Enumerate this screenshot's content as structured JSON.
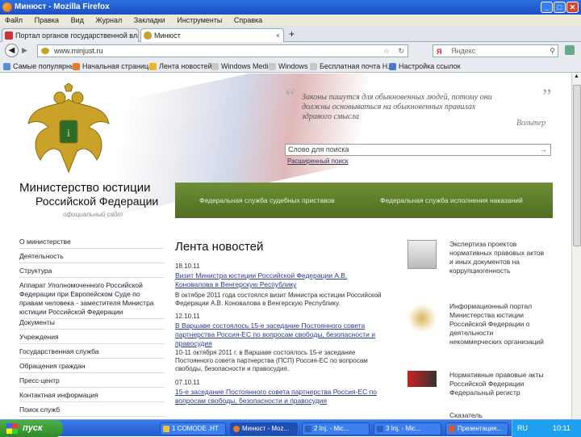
{
  "window": {
    "title": "Минюст - Mozilla Firefox"
  },
  "menu": [
    "Файл",
    "Правка",
    "Вид",
    "Журнал",
    "Закладки",
    "Инструменты",
    "Справка"
  ],
  "tabs": [
    {
      "label": "Портал органов государственной влас...",
      "active": false
    },
    {
      "label": "Минюст",
      "active": true
    }
  ],
  "nav": {
    "url": "www.minjust.ru",
    "search_placeholder": "Яндекс"
  },
  "bookmarks": [
    "Самые популярные",
    "Начальная страница",
    "Лента новостей",
    "Windows Media",
    "Windows",
    "Бесплатная почта H...",
    "Настройка ссылок"
  ],
  "header": {
    "quote": "Законы пишутся для обыкновенных людей, потому они должны основываться на обыкновенных правилах здравого смысла",
    "quote_author": "Вольтер",
    "search_placeholder": "Слово для поиска",
    "search_go": "→",
    "advanced_search": "Расширенный поиск",
    "ministry_line1": "Министерство юстиции",
    "ministry_line2": "Российской Федерации",
    "site_label": "официальный сайт"
  },
  "green_bar": [
    "Федеральная служба судебных приставов",
    "Федеральная служба исполнения наказаний"
  ],
  "left_nav": [
    "О министерстве",
    "Деятельность",
    "Структура",
    "Аппарат Уполномоченного Российской Федерации при Европейском Суде по правам человека - заместителя Министра юстиции Российской Федерации",
    "Документы",
    "Учреждения",
    "Государственная служба",
    "Обращения граждан",
    "Пресс-центр",
    "Контактная информация",
    "Поиск служб"
  ],
  "news": {
    "title": "Лента новостей",
    "items": [
      {
        "date": "18.10.11",
        "headline": "Визит Министра юстиции Российской Федерации А.В. Коновалова в Венгерскую Республику",
        "text": "В октябре 2011 года состоялся визит Министра юстиции Российской Федерации А.В. Коновалова в Венгерскую Республику."
      },
      {
        "date": "12.10.11",
        "headline": "В Варшаве состоялось 15-е заседание Постоянного совета партнерства Россия-ЕС по вопросам свободы, безопасности и правосудия",
        "text": "10-11 октября 2011 г. в Варшаве состоялось 15-е заседание Постоянного совета партнерства (ПСП) Россия-ЕС по вопросам свободы, безопасности и правосудия."
      },
      {
        "date": "07.10.11",
        "headline": "15-е заседание Постоянного совета партнерства Россия-ЕС по вопросам свободы, безопасности и правосудия",
        "text": ""
      }
    ]
  },
  "right_column": [
    {
      "icon": "document-icon",
      "text": "Экспертиза проектов нормативных правовых актов и иных документов на коррупциогенность"
    },
    {
      "icon": "emblem-icon",
      "text": "Информационный портал Министерства юстиции Российской Федерации о деятельности некоммерческих организаций"
    },
    {
      "icon": "register-icon",
      "text": "Нормативные правовые акты Российской Федерации Федеральный регистр"
    },
    {
      "icon": "",
      "text": "Сказатель"
    }
  ],
  "taskbar": {
    "start_label": "пуск",
    "tasks": [
      "1 COMODE .HT",
      "Минюст - Moz...",
      "2 Inj. - Mic...",
      "3 Inj. - Mic...",
      "",
      "Презентация..."
    ],
    "tray_lang": "RU",
    "tray_time": "10:11"
  },
  "colors": {
    "accent_green": "#5a7a28",
    "title_blue": "#1a4fc2"
  }
}
